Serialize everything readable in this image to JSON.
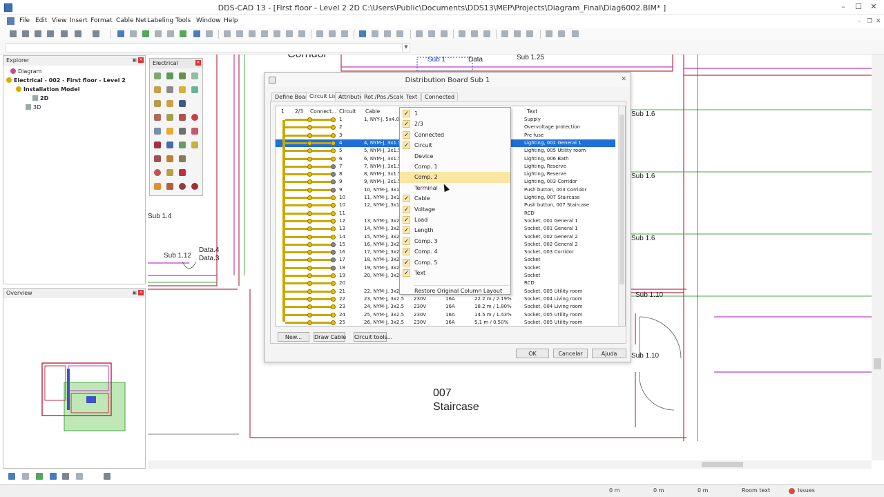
{
  "window": {
    "title": "DDS-CAD 13 - [First floor - Level 2  2D  C:\\Users\\Public\\Documents\\DDS13\\MEP\\Projects\\Diagram_Final\\Diag6002.BIM* ]",
    "minimize": "–",
    "maximize": "☐",
    "close": "✕"
  },
  "menu": {
    "items": [
      "File",
      "Edit",
      "View",
      "Insert",
      "Format",
      "Cable Net",
      "Labeling",
      "Tools",
      "Window",
      "Help"
    ],
    "mdi": [
      "–",
      "❐",
      "✕"
    ]
  },
  "explorer": {
    "title": "Explorer",
    "items": [
      "Diagram",
      "Electrical - 002 - First floor - Level 2",
      "Installation Model",
      "2D",
      "3D"
    ]
  },
  "overview": {
    "title": "Overview"
  },
  "electrical_toolbar": {
    "title": "Electrical"
  },
  "plan": {
    "labels": [
      "Corridor",
      "Sub 1",
      "Data",
      "Sub 1.25",
      "Sub 1.6",
      "Sub 1.6",
      "Sub 1.6",
      "Sub 1.4",
      "Sub 1.12",
      "Data.4",
      "Data.3",
      "Sub 1.10",
      "Sub 1.10"
    ],
    "room_number": "007",
    "room_name": "Staircase"
  },
  "dialog": {
    "title": "Distribution Board Sub 1",
    "close": "✕",
    "tabs": [
      "Define Board",
      "Circuit List",
      "Attributes",
      "Rot./Pos./Scale",
      "Text",
      "Connected"
    ],
    "active_tab": "Circuit List",
    "columns": [
      "1",
      "2/3",
      "Connect...",
      "Circuit",
      "Cable",
      "Text"
    ],
    "rows": [
      {
        "circuit": "1",
        "cable": "1, NYY-J, 5x4.0",
        "v": "",
        "a": "",
        "len": "",
        "text": "Supply"
      },
      {
        "circuit": "2",
        "cable": "",
        "v": "",
        "a": "",
        "len": "",
        "text": "Overvoltage protection"
      },
      {
        "circuit": "3",
        "cable": "",
        "v": "",
        "a": "",
        "len": "",
        "text": "Pre fuse"
      },
      {
        "circuit": "4",
        "cable": "4, NYM-J, 3x1.5",
        "v": "",
        "a": "",
        "len": "",
        "text": "Lighting, 001 General 1",
        "selected": true
      },
      {
        "circuit": "5",
        "cable": "5, NYM-J, 3x1.5",
        "v": "",
        "a": "",
        "len": "",
        "text": "Lighting, 005 Utility room"
      },
      {
        "circuit": "6",
        "cable": "6, NYM-J, 3x1.5",
        "v": "",
        "a": "",
        "len": "",
        "text": "Lighting, 006 Bath"
      },
      {
        "circuit": "7",
        "cable": "7, NYM-J, 3x1.5",
        "v": "",
        "a": "",
        "len": "",
        "text": "Lighting, Reserve"
      },
      {
        "circuit": "8",
        "cable": "8, NYM-J, 3x1.5",
        "v": "",
        "a": "",
        "len": "",
        "text": "Lighting, Reserve"
      },
      {
        "circuit": "9",
        "cable": "9, NYM-J, 3x1.5",
        "v": "",
        "a": "",
        "len": "",
        "text": "Lighting, 003 Corridor"
      },
      {
        "circuit": "9",
        "cable": "10, NYM-J, 3x1.",
        "v": "",
        "a": "",
        "len": "",
        "text": "Push button, 003 Corridor"
      },
      {
        "circuit": "10",
        "cable": "11, NYM-J, 3x1.",
        "v": "",
        "a": "",
        "len": "",
        "text": "Lighting, 007 Staircase"
      },
      {
        "circuit": "10",
        "cable": "12, NYM-J, 3x1.",
        "v": "",
        "a": "",
        "len": "",
        "text": "Push button, 007 Staircase"
      },
      {
        "circuit": "11",
        "cable": "",
        "v": "",
        "a": "",
        "len": "",
        "text": "RCD"
      },
      {
        "circuit": "12",
        "cable": "13, NYM-J, 3x2.",
        "v": "",
        "a": "",
        "len": "",
        "text": "Socket, 001 General 1"
      },
      {
        "circuit": "13",
        "cable": "14, NYM-J, 3x2.",
        "v": "",
        "a": "",
        "len": "",
        "text": "Socket, 001 General 1"
      },
      {
        "circuit": "14",
        "cable": "15, NYM-J, 3x2.",
        "v": "",
        "a": "",
        "len": "",
        "text": "Socket, 002 General 2"
      },
      {
        "circuit": "15",
        "cable": "16, NYM-J, 3x2.",
        "v": "",
        "a": "",
        "len": "",
        "text": "Socket, 002 General 2"
      },
      {
        "circuit": "16",
        "cable": "17, NYM-J, 3x2.",
        "v": "",
        "a": "",
        "len": "",
        "text": "Socket, 003 Corridor"
      },
      {
        "circuit": "17",
        "cable": "18, NYM-J, 3x2.",
        "v": "",
        "a": "",
        "len": "",
        "text": "Socket"
      },
      {
        "circuit": "18",
        "cable": "19, NYM-J, 3x2.",
        "v": "",
        "a": "",
        "len": "",
        "text": "Socket"
      },
      {
        "circuit": "19",
        "cable": "20, NYM-J, 3x2.",
        "v": "",
        "a": "",
        "len": "",
        "text": "Socket"
      },
      {
        "circuit": "20",
        "cable": "",
        "v": "",
        "a": "",
        "len": "",
        "text": "RCD"
      },
      {
        "circuit": "21",
        "cable": "22, NYM-J, 3x2.5",
        "v": "230V",
        "a": "16A",
        "len": "",
        "text": "Socket, 005 Utility room"
      },
      {
        "circuit": "22",
        "cable": "23, NYM-J, 3x2.5",
        "v": "230V",
        "a": "16A",
        "len": "22.2 m / 2.19%",
        "text": "Socket, 004 Living room"
      },
      {
        "circuit": "23",
        "cable": "24, NYM-J, 3x2.5",
        "v": "230V",
        "a": "16A",
        "len": "18.2 m / 1.80%",
        "text": "Socket, 004 Living room"
      },
      {
        "circuit": "24",
        "cable": "25, NYM-J, 3x2.5",
        "v": "230V",
        "a": "16A",
        "len": "14.5 m / 1.43%",
        "text": "Socket, 005 Utility room"
      },
      {
        "circuit": "25",
        "cable": "26, NYM-J, 3x2.5",
        "v": "230V",
        "a": "16A",
        "len": "5.1 m / 0.50%",
        "text": "Socket, 005 Utility room"
      }
    ],
    "buttons": {
      "new": "New...",
      "draw_cable": "Draw Cable",
      "circuit_tools": "Circuit tools...",
      "ok": "OK",
      "cancel": "Cancelar",
      "help": "Ajuda"
    }
  },
  "context_menu": {
    "items": [
      {
        "label": "1",
        "checked": true
      },
      {
        "label": "2/3",
        "checked": true
      },
      {
        "label": "Connected",
        "checked": true
      },
      {
        "label": "Circuit",
        "checked": true
      },
      {
        "label": "Device",
        "checked": false
      },
      {
        "label": "Comp. 1",
        "checked": false
      },
      {
        "label": "Comp. 2",
        "checked": false,
        "highlighted": true
      },
      {
        "label": "Terminal",
        "checked": false
      },
      {
        "label": "Cable",
        "checked": true
      },
      {
        "label": "Voltage",
        "checked": true
      },
      {
        "label": "Load",
        "checked": true
      },
      {
        "label": "Length",
        "checked": true
      },
      {
        "label": "Comp. 3",
        "checked": true
      },
      {
        "label": "Comp. 4",
        "checked": true
      },
      {
        "label": "Comp. 5",
        "checked": true
      },
      {
        "label": "Text",
        "checked": true
      }
    ],
    "restore": "Restore Original Column Layout",
    "check_glyph": "✓"
  },
  "status": {
    "x": "0 m",
    "y": "0 m",
    "z": "0 m",
    "mode": "Room text",
    "issues": "Issues"
  },
  "colors": {
    "bus": "#c9a800",
    "node": "#e9c000",
    "selection": "#1e6fd8",
    "highlight": "#fbe6a2",
    "wall_red": "#c0304a",
    "wall_magenta": "#c13cc1",
    "data_blue": "#1c3fb8"
  }
}
